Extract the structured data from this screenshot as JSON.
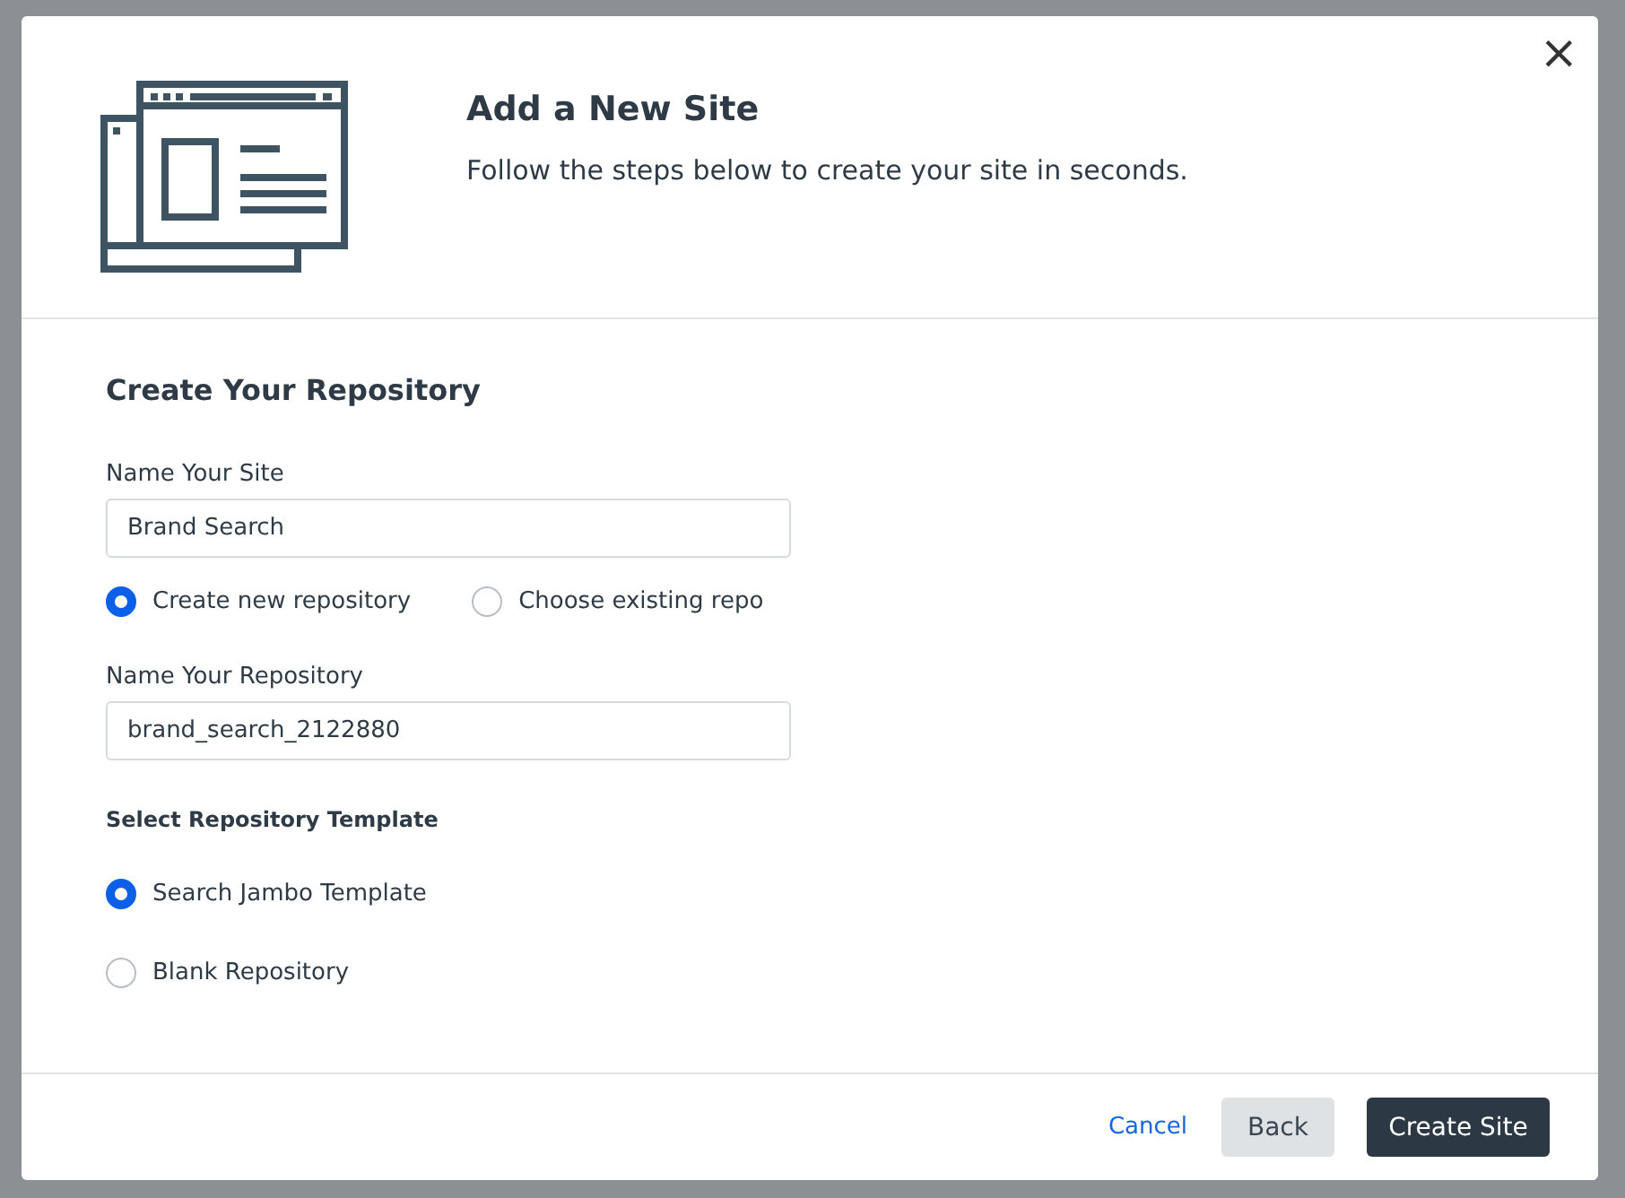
{
  "dialog": {
    "title": "Add a New Site",
    "subtitle": "Follow the steps below to create your site in seconds.",
    "close": "×"
  },
  "section_title": "Create Your Repository",
  "site_name": {
    "label": "Name Your Site",
    "value": "Brand Search"
  },
  "repo_mode": [
    {
      "label": "Create new repository",
      "selected": true
    },
    {
      "label": "Choose existing repo",
      "selected": false
    }
  ],
  "repo_name": {
    "label": "Name Your Repository",
    "value": "brand_search_2122880"
  },
  "template": {
    "label": "Select Repository Template",
    "options": [
      {
        "label": "Search Jambo Template",
        "selected": true
      },
      {
        "label": "Blank Repository",
        "selected": false
      }
    ]
  },
  "footer": {
    "cancel": "Cancel",
    "back": "Back",
    "create": "Create Site"
  }
}
